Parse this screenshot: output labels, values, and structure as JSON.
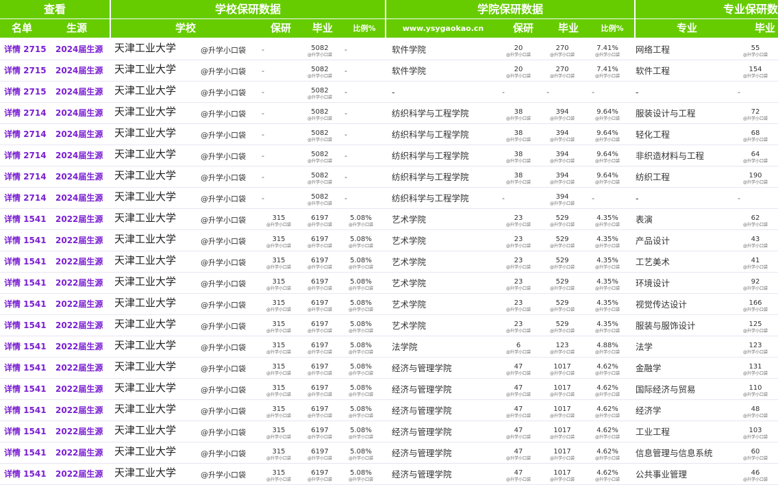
{
  "header": {
    "groups": {
      "view": "查看",
      "school": "学校保研数据",
      "college": "学院保研数据",
      "major": "专业保研数"
    },
    "columns": {
      "rank": "名单",
      "cohort": "生源",
      "school": "学校",
      "school_baoyan": "保研",
      "school_grad": "毕业",
      "school_ratio": "比例%",
      "site": "www.ysygaokao.cn",
      "college_baoyan": "保研",
      "college_grad": "毕业",
      "college_ratio": "比例%",
      "major": "专业",
      "major_grad": "毕业"
    }
  },
  "watermark": "@升学小口袋",
  "colors": {
    "header_bg": "#66cc00",
    "link_purple": "#7a1fd1"
  },
  "rows": [
    {
      "detail": "详情 2715",
      "cohort": "2024届生源",
      "school": "天津工业大学",
      "s_by": "-",
      "s_grad": "5082",
      "s_ratio": "-",
      "college": "软件学院",
      "c_by": "20",
      "c_grad": "270",
      "c_ratio": "7.41%",
      "major": "网络工程",
      "m_grad": "55"
    },
    {
      "detail": "详情 2715",
      "cohort": "2024届生源",
      "school": "天津工业大学",
      "s_by": "-",
      "s_grad": "5082",
      "s_ratio": "-",
      "college": "软件学院",
      "c_by": "20",
      "c_grad": "270",
      "c_ratio": "7.41%",
      "major": "软件工程",
      "m_grad": "154"
    },
    {
      "detail": "详情 2715",
      "cohort": "2024届生源",
      "school": "天津工业大学",
      "s_by": "-",
      "s_grad": "5082",
      "s_ratio": "-",
      "college": "-",
      "c_by": "-",
      "c_grad": "-",
      "c_ratio": "-",
      "major": "-",
      "m_grad": "-"
    },
    {
      "detail": "详情 2714",
      "cohort": "2024届生源",
      "school": "天津工业大学",
      "s_by": "-",
      "s_grad": "5082",
      "s_ratio": "-",
      "college": "纺织科学与工程学院",
      "c_by": "38",
      "c_grad": "394",
      "c_ratio": "9.64%",
      "major": "服装设计与工程",
      "m_grad": "72"
    },
    {
      "detail": "详情 2714",
      "cohort": "2024届生源",
      "school": "天津工业大学",
      "s_by": "-",
      "s_grad": "5082",
      "s_ratio": "-",
      "college": "纺织科学与工程学院",
      "c_by": "38",
      "c_grad": "394",
      "c_ratio": "9.64%",
      "major": "轻化工程",
      "m_grad": "68"
    },
    {
      "detail": "详情 2714",
      "cohort": "2024届生源",
      "school": "天津工业大学",
      "s_by": "-",
      "s_grad": "5082",
      "s_ratio": "-",
      "college": "纺织科学与工程学院",
      "c_by": "38",
      "c_grad": "394",
      "c_ratio": "9.64%",
      "major": "非织造材料与工程",
      "m_grad": "64"
    },
    {
      "detail": "详情 2714",
      "cohort": "2024届生源",
      "school": "天津工业大学",
      "s_by": "-",
      "s_grad": "5082",
      "s_ratio": "-",
      "college": "纺织科学与工程学院",
      "c_by": "38",
      "c_grad": "394",
      "c_ratio": "9.64%",
      "major": "纺织工程",
      "m_grad": "190"
    },
    {
      "detail": "详情 2714",
      "cohort": "2024届生源",
      "school": "天津工业大学",
      "s_by": "-",
      "s_grad": "5082",
      "s_ratio": "-",
      "college": "纺织科学与工程学院",
      "c_by": "-",
      "c_grad": "394",
      "c_ratio": "-",
      "major": "-",
      "m_grad": "-"
    },
    {
      "detail": "详情 1541",
      "cohort": "2022届生源",
      "school": "天津工业大学",
      "s_by": "315",
      "s_grad": "6197",
      "s_ratio": "5.08%",
      "college": "艺术学院",
      "c_by": "23",
      "c_grad": "529",
      "c_ratio": "4.35%",
      "major": "表演",
      "m_grad": "62"
    },
    {
      "detail": "详情 1541",
      "cohort": "2022届生源",
      "school": "天津工业大学",
      "s_by": "315",
      "s_grad": "6197",
      "s_ratio": "5.08%",
      "college": "艺术学院",
      "c_by": "23",
      "c_grad": "529",
      "c_ratio": "4.35%",
      "major": "产品设计",
      "m_grad": "43"
    },
    {
      "detail": "详情 1541",
      "cohort": "2022届生源",
      "school": "天津工业大学",
      "s_by": "315",
      "s_grad": "6197",
      "s_ratio": "5.08%",
      "college": "艺术学院",
      "c_by": "23",
      "c_grad": "529",
      "c_ratio": "4.35%",
      "major": "工艺美术",
      "m_grad": "41"
    },
    {
      "detail": "详情 1541",
      "cohort": "2022届生源",
      "school": "天津工业大学",
      "s_by": "315",
      "s_grad": "6197",
      "s_ratio": "5.08%",
      "college": "艺术学院",
      "c_by": "23",
      "c_grad": "529",
      "c_ratio": "4.35%",
      "major": "环境设计",
      "m_grad": "92"
    },
    {
      "detail": "详情 1541",
      "cohort": "2022届生源",
      "school": "天津工业大学",
      "s_by": "315",
      "s_grad": "6197",
      "s_ratio": "5.08%",
      "college": "艺术学院",
      "c_by": "23",
      "c_grad": "529",
      "c_ratio": "4.35%",
      "major": "视觉传达设计",
      "m_grad": "166"
    },
    {
      "detail": "详情 1541",
      "cohort": "2022届生源",
      "school": "天津工业大学",
      "s_by": "315",
      "s_grad": "6197",
      "s_ratio": "5.08%",
      "college": "艺术学院",
      "c_by": "23",
      "c_grad": "529",
      "c_ratio": "4.35%",
      "major": "服装与服饰设计",
      "m_grad": "125"
    },
    {
      "detail": "详情 1541",
      "cohort": "2022届生源",
      "school": "天津工业大学",
      "s_by": "315",
      "s_grad": "6197",
      "s_ratio": "5.08%",
      "college": "法学院",
      "c_by": "6",
      "c_grad": "123",
      "c_ratio": "4.88%",
      "major": "法学",
      "m_grad": "123"
    },
    {
      "detail": "详情 1541",
      "cohort": "2022届生源",
      "school": "天津工业大学",
      "s_by": "315",
      "s_grad": "6197",
      "s_ratio": "5.08%",
      "college": "经济与管理学院",
      "c_by": "47",
      "c_grad": "1017",
      "c_ratio": "4.62%",
      "major": "金融学",
      "m_grad": "131"
    },
    {
      "detail": "详情 1541",
      "cohort": "2022届生源",
      "school": "天津工业大学",
      "s_by": "315",
      "s_grad": "6197",
      "s_ratio": "5.08%",
      "college": "经济与管理学院",
      "c_by": "47",
      "c_grad": "1017",
      "c_ratio": "4.62%",
      "major": "国际经济与贸易",
      "m_grad": "110"
    },
    {
      "detail": "详情 1541",
      "cohort": "2022届生源",
      "school": "天津工业大学",
      "s_by": "315",
      "s_grad": "6197",
      "s_ratio": "5.08%",
      "college": "经济与管理学院",
      "c_by": "47",
      "c_grad": "1017",
      "c_ratio": "4.62%",
      "major": "经济学",
      "m_grad": "48"
    },
    {
      "detail": "详情 1541",
      "cohort": "2022届生源",
      "school": "天津工业大学",
      "s_by": "315",
      "s_grad": "6197",
      "s_ratio": "5.08%",
      "college": "经济与管理学院",
      "c_by": "47",
      "c_grad": "1017",
      "c_ratio": "4.62%",
      "major": "工业工程",
      "m_grad": "103"
    },
    {
      "detail": "详情 1541",
      "cohort": "2022届生源",
      "school": "天津工业大学",
      "s_by": "315",
      "s_grad": "6197",
      "s_ratio": "5.08%",
      "college": "经济与管理学院",
      "c_by": "47",
      "c_grad": "1017",
      "c_ratio": "4.62%",
      "major": "信息管理与信息系统",
      "m_grad": "60"
    },
    {
      "detail": "详情 1541",
      "cohort": "2022届生源",
      "school": "天津工业大学",
      "s_by": "315",
      "s_grad": "6197",
      "s_ratio": "5.08%",
      "college": "经济与管理学院",
      "c_by": "47",
      "c_grad": "1017",
      "c_ratio": "4.62%",
      "major": "公共事业管理",
      "m_grad": "46"
    }
  ]
}
